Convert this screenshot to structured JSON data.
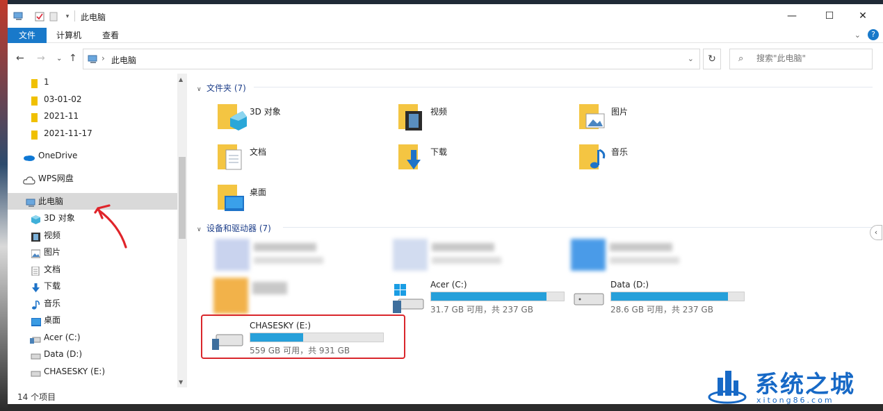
{
  "window": {
    "title": "此电脑",
    "controls": {
      "minimize": "—",
      "maximize": "☐",
      "close": "✕"
    }
  },
  "ribbon": {
    "tabs": [
      "文件",
      "计算机",
      "查看"
    ],
    "help": "?"
  },
  "address": {
    "path": "此电脑",
    "search_placeholder": "搜索\"此电脑\""
  },
  "nav": {
    "items": [
      {
        "label": "1",
        "icon": "folder-icon"
      },
      {
        "label": "03-01-02",
        "icon": "folder-icon"
      },
      {
        "label": "2021-11",
        "icon": "folder-icon"
      },
      {
        "label": "2021-11-17",
        "icon": "folder-icon"
      },
      {
        "label": "OneDrive",
        "icon": "onedrive-icon"
      },
      {
        "label": "WPS网盘",
        "icon": "cloud-icon"
      },
      {
        "label": "此电脑",
        "icon": "this-pc-icon",
        "selected": true
      },
      {
        "label": "3D 对象",
        "icon": "3d-objects-icon"
      },
      {
        "label": "视频",
        "icon": "videos-icon"
      },
      {
        "label": "图片",
        "icon": "pictures-icon"
      },
      {
        "label": "文档",
        "icon": "documents-icon"
      },
      {
        "label": "下载",
        "icon": "downloads-icon"
      },
      {
        "label": "音乐",
        "icon": "music-icon"
      },
      {
        "label": "桌面",
        "icon": "desktop-icon"
      },
      {
        "label": "Acer (C:)",
        "icon": "drive-icon"
      },
      {
        "label": "Data (D:)",
        "icon": "drive-icon"
      },
      {
        "label": "CHASESKY (E:)",
        "icon": "drive-icon"
      }
    ],
    "status": "14 个项目"
  },
  "folders": {
    "header": "文件夹 (7)",
    "items": [
      {
        "label": "3D 对象",
        "icon": "3d-objects-icon"
      },
      {
        "label": "视频",
        "icon": "videos-icon"
      },
      {
        "label": "图片",
        "icon": "pictures-icon"
      },
      {
        "label": "文档",
        "icon": "documents-icon"
      },
      {
        "label": "下载",
        "icon": "downloads-icon"
      },
      {
        "label": "音乐",
        "icon": "music-icon"
      },
      {
        "label": "桌面",
        "icon": "desktop-icon"
      }
    ]
  },
  "devices": {
    "header": "设备和驱动器 (7)",
    "drives": [
      {
        "name": "Acer (C:)",
        "info": "31.7 GB 可用，共 237 GB",
        "used_fraction": 0.87
      },
      {
        "name": "Data (D:)",
        "info": "28.6 GB 可用，共 237 GB",
        "used_fraction": 0.88
      },
      {
        "name": "CHASESKY (E:)",
        "info": "559 GB 可用，共 931 GB",
        "used_fraction": 0.4
      }
    ]
  },
  "watermark": {
    "name": "系统之城",
    "url": "xitong86.com"
  },
  "colors": {
    "accent": "#1979ca",
    "drive_fill": "#26a0da",
    "highlight": "#d9262b"
  }
}
